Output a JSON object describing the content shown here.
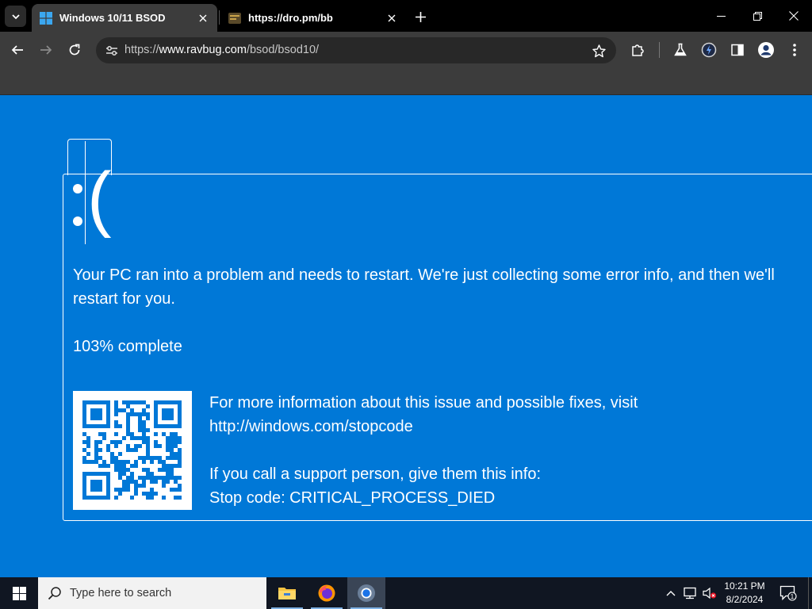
{
  "browser": {
    "tabs": [
      {
        "title": "Windows 10/11 BSOD",
        "active": true
      },
      {
        "title": "https://dro.pm/bb",
        "active": false
      }
    ],
    "url": {
      "scheme": "https://",
      "host": "www.ravbug.com",
      "path": "/bsod/bsod10/"
    }
  },
  "bsod": {
    "message": "Your PC ran into a problem and needs to restart. We're just collecting some error info, and then we'll restart for you.",
    "progress": "103% complete",
    "info_line1": "For more information about this issue and possible fixes, visit",
    "info_url": "http://windows.com/stopcode",
    "support_line": "If you call a support person, give them this info:",
    "stop_code": "Stop code: CRITICAL_PROCESS_DIED",
    "frown": "(",
    "background_color": "#0078d7"
  },
  "taskbar": {
    "search_placeholder": "Type here to search",
    "apps": [
      "file-explorer",
      "firefox",
      "chrome"
    ],
    "time": "10:21 PM",
    "date": "8/2/2024",
    "notification_count": "1"
  }
}
